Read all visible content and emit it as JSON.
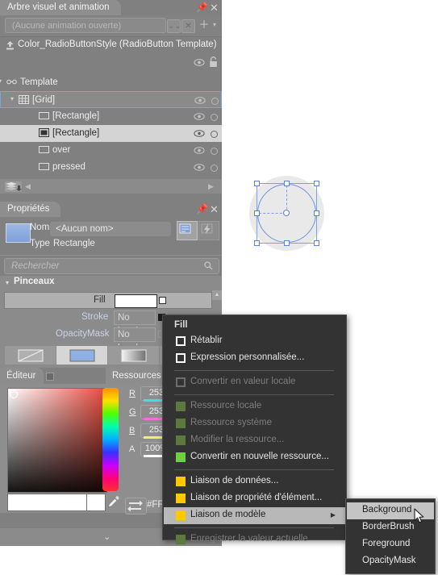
{
  "visual_tree_panel": {
    "tab_title": "Arbre visuel et animation",
    "pin_icon": "pin-icon",
    "close_icon": "close-icon",
    "animation_combo_value": "(Aucune animation ouverte)",
    "animation_buttons": [
      {
        "name": "collapse-all-button",
        "glyph": "⌄⌄"
      },
      {
        "name": "delete-animation-button",
        "glyph": "✕"
      },
      {
        "name": "add-animation-button",
        "glyph": "＋"
      },
      {
        "name": "animation-dropdown-arrow",
        "glyph": "▾"
      }
    ],
    "template_breadcrumb": "Color_RadioButtonStyle (RadioButton Template)",
    "template_icon": "return-scope-icon",
    "header_eye_icon": "eye-icon",
    "header_lock_icon": "lock-icon",
    "tree": [
      {
        "label": "Template",
        "indent": 8,
        "icon": "template-icon",
        "expander": "▾",
        "selected": "none",
        "has_eye": false,
        "has_dot": false
      },
      {
        "label": "[Grid]",
        "indent": 22,
        "icon": "grid-icon",
        "expander": "▾",
        "selected": "blue",
        "has_eye": true,
        "has_dot": true
      },
      {
        "label": "[Rectangle]",
        "indent": 48,
        "icon": "rectangle-icon",
        "expander": "",
        "selected": "none",
        "has_eye": true,
        "has_dot": true
      },
      {
        "label": "[Rectangle]",
        "indent": 48,
        "icon": "rectangle-filled-icon",
        "expander": "",
        "selected": "light",
        "has_eye": true,
        "has_dot": true
      },
      {
        "label": "over",
        "indent": 48,
        "icon": "rectangle-icon",
        "expander": "",
        "selected": "none",
        "has_eye": true,
        "has_dot": true
      },
      {
        "label": "pressed",
        "indent": 48,
        "icon": "rectangle-icon",
        "expander": "",
        "selected": "none",
        "has_eye": true,
        "has_dot": true
      }
    ],
    "scroll_left_arrow": "◀",
    "scroll_right_arrow": "▶",
    "layers_icon": "layers-icon"
  },
  "properties_panel": {
    "tab_title": "Propriétés",
    "pin_icon": "pin-icon",
    "close_icon": "close-icon",
    "name_label": "Nom",
    "name_value": "<Aucun nom>",
    "type_label": "Type",
    "type_value": "Rectangle",
    "toggle_buttons": [
      {
        "name": "show-advanced-properties-button",
        "active": true
      },
      {
        "name": "events-button",
        "active": false
      }
    ],
    "search_placeholder": "Rechercher",
    "search_icon": "search-icon",
    "brushes": {
      "section_title": "Pinceaux",
      "caret": "▾",
      "rows": [
        {
          "name": "Fill",
          "value": "",
          "kind": "swatch",
          "swatch_color": "#FFFFFF",
          "adv": "local",
          "selected": true
        },
        {
          "name": "Stroke",
          "value": "No brush",
          "kind": "text",
          "adv": "local",
          "selected": false
        },
        {
          "name": "OpacityMask",
          "value": "No brush",
          "kind": "text",
          "adv": "none",
          "selected": false
        }
      ],
      "brush_tabs": [
        {
          "name": "no-brush-tab",
          "icon": "no-brush-icon",
          "selected": false
        },
        {
          "name": "solid-color-brush-tab",
          "icon": "solid-color-icon",
          "selected": true
        },
        {
          "name": "gradient-brush-tab",
          "icon": "gradient-icon",
          "selected": false
        },
        {
          "name": "tile-brush-tab",
          "icon": "tile-brush-icon",
          "selected": false
        }
      ],
      "scroll_up_arrow": "▲"
    },
    "editor_tabs": [
      {
        "label": "Éditeur",
        "active": true
      },
      {
        "label": "Ressources c",
        "active": false
      }
    ],
    "color_editor": {
      "channels": [
        {
          "label": "R",
          "value": "253",
          "underline": "#3fe0e0"
        },
        {
          "label": "G",
          "value": "253",
          "underline": "#f070d8"
        },
        {
          "label": "B",
          "value": "253",
          "underline": "#f2f06a"
        },
        {
          "label": "A",
          "value": "100%",
          "underline": "#ffffff"
        }
      ],
      "hex_value": "#FFF",
      "eyedropper_icon": "eyedropper-icon",
      "swap_icon": "swap-colors-icon",
      "expand_chevron": "⌄"
    }
  },
  "context_menu": {
    "title": "Fill",
    "items": [
      {
        "label": "Rétablir",
        "marker": "checkbox",
        "enabled": true,
        "highlighted": false,
        "submenu": false
      },
      {
        "label": "Expression personnalisée...",
        "marker": "checkbox",
        "enabled": true,
        "highlighted": false,
        "submenu": false
      },
      {
        "sep": true
      },
      {
        "label": "Convertir en valeur locale",
        "marker": "checkbox",
        "enabled": false,
        "highlighted": false,
        "submenu": false
      },
      {
        "sep": true
      },
      {
        "label": "Ressource locale",
        "marker": "swatch",
        "color": "#5d7a3e",
        "enabled": false,
        "highlighted": false,
        "submenu": false
      },
      {
        "label": "Ressource système",
        "marker": "swatch",
        "color": "#5d7a3e",
        "enabled": false,
        "highlighted": false,
        "submenu": false
      },
      {
        "label": "Modifier la ressource...",
        "marker": "swatch",
        "color": "#5d7a3e",
        "enabled": false,
        "highlighted": false,
        "submenu": false
      },
      {
        "label": "Convertir en nouvelle ressource...",
        "marker": "swatch",
        "color": "#6ecf42",
        "enabled": true,
        "highlighted": false,
        "submenu": false
      },
      {
        "sep": true
      },
      {
        "label": "Liaison de données...",
        "marker": "swatch",
        "color": "#ffc800",
        "enabled": true,
        "highlighted": false,
        "submenu": false
      },
      {
        "label": "Liaison de propriété d'élément...",
        "marker": "swatch",
        "color": "#ffc800",
        "enabled": true,
        "highlighted": false,
        "submenu": false
      },
      {
        "label": "Liaison de modèle",
        "marker": "swatch",
        "color": "#ffc800",
        "enabled": true,
        "highlighted": true,
        "submenu": true
      },
      {
        "sep": true
      },
      {
        "label": "Enregistrer la valeur actuelle",
        "marker": "swatch",
        "color": "#5d7a3e",
        "enabled": false,
        "highlighted": false,
        "submenu": false
      }
    ],
    "submenu_arrow": "▶",
    "submenu": {
      "items": [
        {
          "label": "Background",
          "highlighted": true
        },
        {
          "label": "BorderBrush",
          "highlighted": false
        },
        {
          "label": "Foreground",
          "highlighted": false
        },
        {
          "label": "OpacityMask",
          "highlighted": false
        }
      ]
    }
  },
  "canvas": {
    "selection_handles": 8,
    "origin_marker": "transform-origin-icon",
    "shape": "ellipse"
  },
  "colors": {
    "panel_bg": "#808080",
    "menu_bg": "#333333",
    "selection_blue": "#7ba0e6",
    "highlight": "#b8b8b8"
  }
}
